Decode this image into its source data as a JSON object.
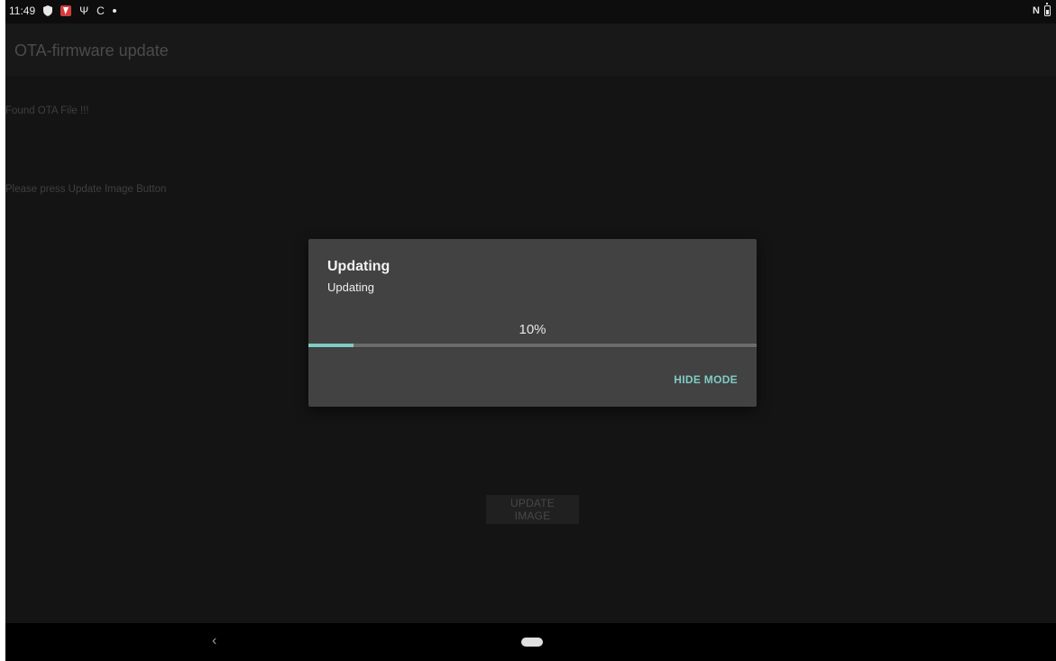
{
  "status_bar": {
    "time": "11:49",
    "left_icons": [
      "shield-icon",
      "no-sim-icon",
      "usb-icon",
      "sync-icon",
      "dot-icon"
    ],
    "right_icons": [
      "nfc-icon",
      "battery-icon"
    ],
    "nfc_glyph": "N",
    "usb_glyph": "Ψ",
    "sync_glyph": "C"
  },
  "app_bar": {
    "title": "OTA-firmware update"
  },
  "content": {
    "message_1": "Found OTA File !!!",
    "message_2": "Please press Update Image Button",
    "update_button_label": "UPDATE IMAGE"
  },
  "dialog": {
    "title": "Updating",
    "message": "Updating",
    "progress_text": "10%",
    "progress_value": 0.1,
    "button_label": "HIDE MODE",
    "accent_color": "#80cbc4"
  },
  "nav_bar": {
    "back_glyph": "‹"
  }
}
